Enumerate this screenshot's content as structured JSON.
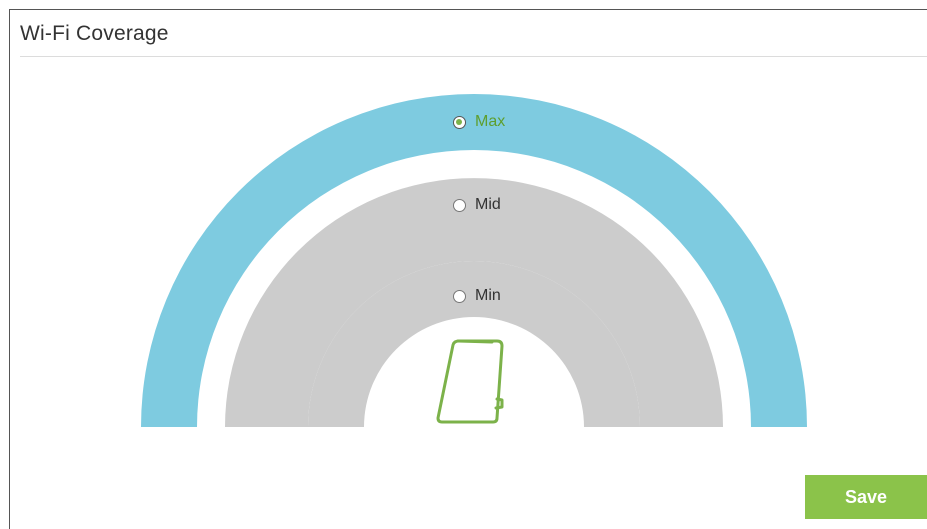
{
  "panel": {
    "title": "Wi-Fi Coverage"
  },
  "coverage": {
    "selected": "Max",
    "options": [
      {
        "id": "max",
        "label": "Max",
        "checked": true
      },
      {
        "id": "mid",
        "label": "Mid",
        "checked": false
      },
      {
        "id": "min",
        "label": "Min",
        "checked": false
      }
    ],
    "colors": {
      "active_arc": "#7ecbe0",
      "inactive_arc": "#cccccc",
      "device_outline": "#7cb24a",
      "selected_text": "#5e9e2e"
    },
    "device_icon": "range-extender-icon"
  },
  "actions": {
    "save_label": "Save",
    "save_color": "#8bc34a"
  }
}
